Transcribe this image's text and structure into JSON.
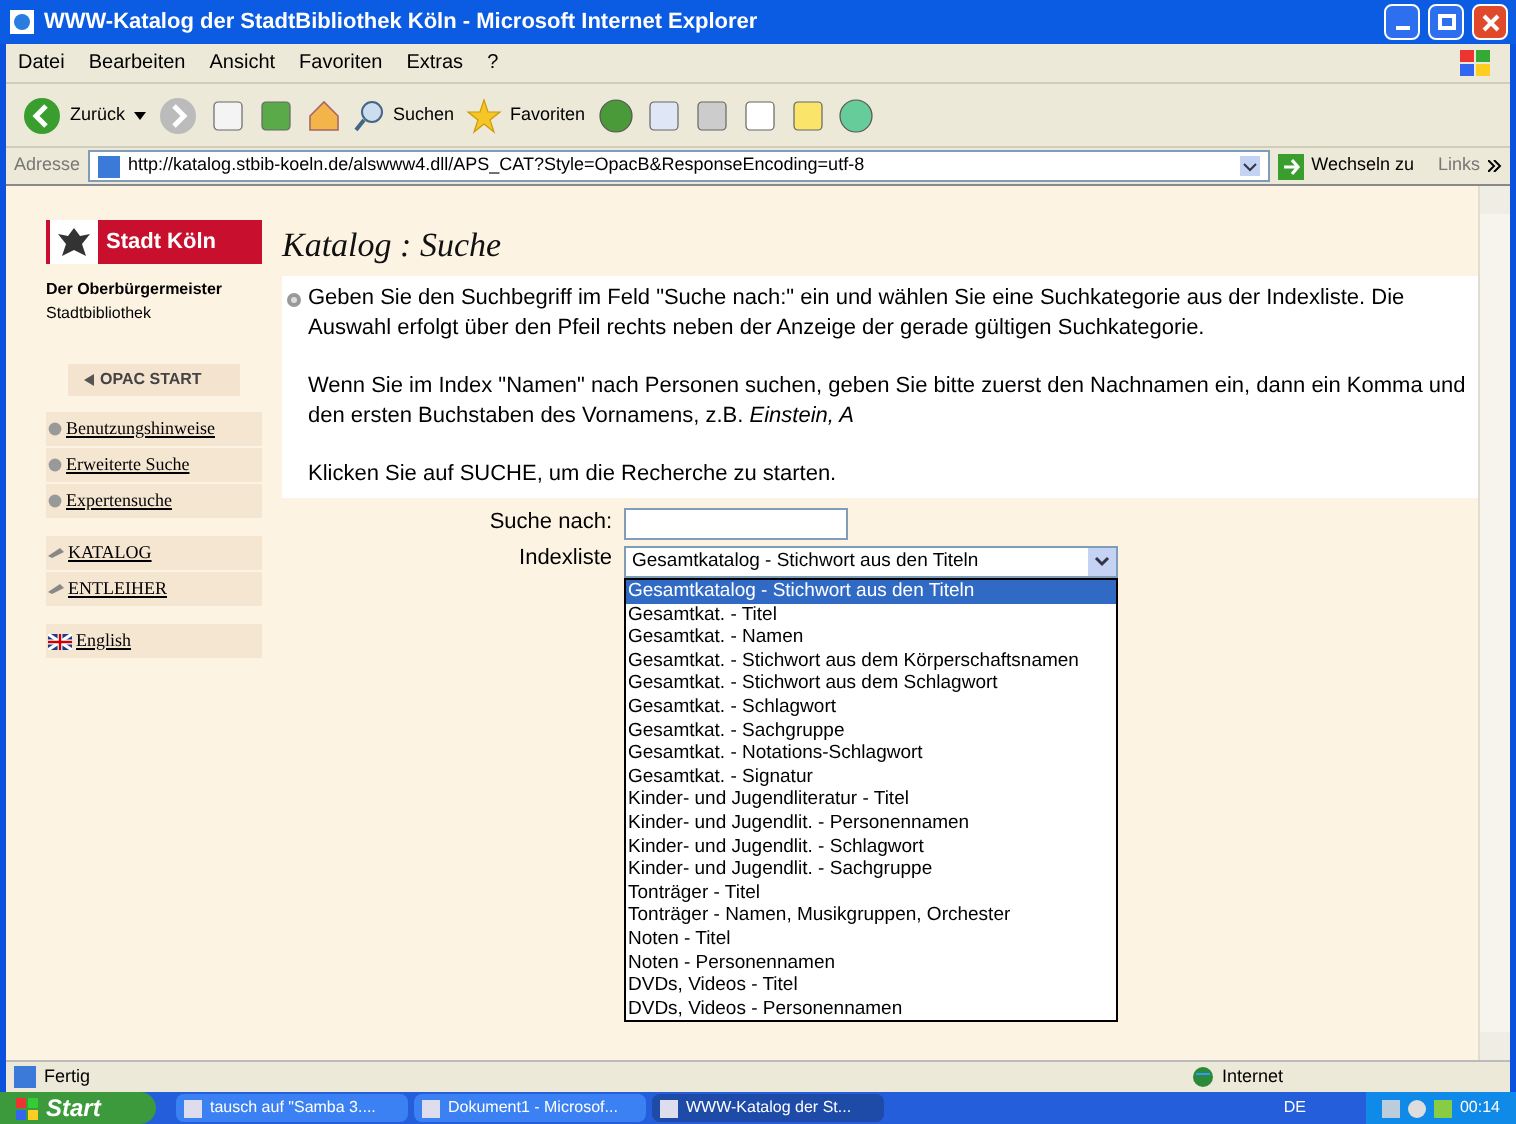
{
  "window": {
    "title": "WWW-Katalog der StadtBibliothek Köln - Microsoft Internet Explorer"
  },
  "menu": [
    "Datei",
    "Bearbeiten",
    "Ansicht",
    "Favoriten",
    "Extras",
    "?"
  ],
  "toolbar": {
    "back": "Zurück",
    "search": "Suchen",
    "favorites": "Favoriten"
  },
  "address": {
    "label": "Adresse",
    "url": "http://katalog.stbib-koeln.de/alswww4.dll/APS_CAT?Style=OpacB&ResponseEncoding=utf-8",
    "go": "Wechseln zu",
    "links": "Links"
  },
  "sidebar": {
    "logo": "Stadt Köln",
    "org": "Der Oberbürgermeister",
    "dept": "Stadtbibliothek",
    "start": "OPAC START",
    "groups": [
      [
        {
          "label": "Benutzungshinweise",
          "kind": "dot"
        },
        {
          "label": "Erweiterte Suche",
          "kind": "dot"
        },
        {
          "label": "Expertensuche",
          "kind": "dot"
        }
      ],
      [
        {
          "label": "KATALOG",
          "kind": "pen"
        },
        {
          "label": "ENTLEIHER",
          "kind": "pen"
        }
      ],
      [
        {
          "label": "English",
          "kind": "flag"
        }
      ]
    ]
  },
  "page": {
    "title": "Katalog : Suche",
    "paragraphs": [
      "Geben Sie den Suchbegriff im Feld \"Suche nach:\" ein und wählen Sie eine Suchkategorie aus der Indexliste. Die Auswahl erfolgt über den Pfeil rechts neben der Anzeige der gerade gültigen Suchkategorie.",
      "Wenn Sie im Index \"Namen\" nach Personen suchen, geben Sie bitte zuerst den Nachnamen ein, dann ein Komma und den ersten Buchstaben des Vornamens, z.B. *Einstein, A*",
      "Klicken Sie auf SUCHE, um die Recherche zu starten."
    ],
    "search_label": "Suche nach:",
    "index_label": "Indexliste",
    "index_value": "Gesamtkatalog - Stichwort aus den Titeln",
    "options": [
      {
        "label": "Gesamtkatalog - Stichwort aus den Titeln",
        "selected": true
      },
      {
        "label": "Gesamtkat. - Titel",
        "selected": false
      },
      {
        "label": "Gesamtkat. - Namen",
        "selected": false
      },
      {
        "label": "Gesamtkat. - Stichwort aus dem Körperschaftsnamen",
        "selected": false
      },
      {
        "label": "Gesamtkat. - Stichwort aus dem Schlagwort",
        "selected": false
      },
      {
        "label": "Gesamtkat. - Schlagwort",
        "selected": false
      },
      {
        "label": "Gesamtkat. - Sachgruppe",
        "selected": false
      },
      {
        "label": "Gesamtkat. - Notations-Schlagwort",
        "selected": false
      },
      {
        "label": "Gesamtkat. - Signatur",
        "selected": false
      },
      {
        "label": "Kinder- und Jugendliteratur - Titel",
        "selected": false
      },
      {
        "label": "Kinder- und Jugendlit. - Personennamen",
        "selected": false
      },
      {
        "label": "Kinder- und Jugendlit. - Schlagwort",
        "selected": false
      },
      {
        "label": "Kinder- und Jugendlit. - Sachgruppe",
        "selected": false
      },
      {
        "label": "Tonträger - Titel",
        "selected": false
      },
      {
        "label": "Tonträger - Namen, Musikgruppen, Orchester",
        "selected": false
      },
      {
        "label": "Noten - Titel",
        "selected": false
      },
      {
        "label": "Noten - Personennamen",
        "selected": false
      },
      {
        "label": "DVDs, Videos - Titel",
        "selected": false
      },
      {
        "label": "DVDs, Videos - Personennamen",
        "selected": false
      }
    ]
  },
  "status_bar": {
    "text": "Fertig",
    "zone": "Internet"
  },
  "taskbar": {
    "start": "Start",
    "tasks": [
      {
        "label": "tausch auf \"Samba 3....",
        "selected": false
      },
      {
        "label": "Dokument1 - Microsof...",
        "selected": false
      },
      {
        "label": "WWW-Katalog der St...",
        "selected": true
      }
    ],
    "lang": "DE",
    "time": "00:14"
  }
}
